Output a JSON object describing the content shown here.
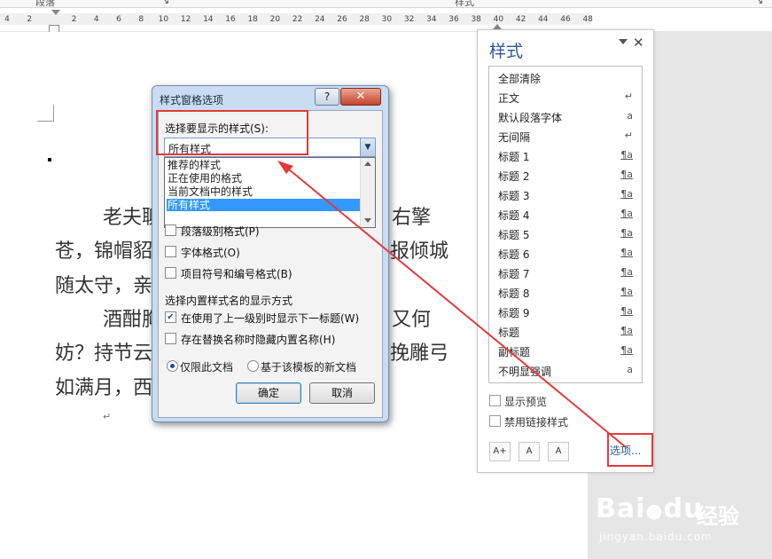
{
  "ribbon": {
    "group_left": "段落",
    "group_right": "样式",
    "launcher": "↘"
  },
  "ruler": {
    "ticks": [
      "4",
      "2",
      "",
      "2",
      "4",
      "6",
      "8",
      "10",
      "12",
      "14",
      "16",
      "18",
      "20",
      "22",
      "24",
      "26",
      "28",
      "30",
      "32",
      "34",
      "36",
      "38",
      "40",
      "42",
      "44",
      "46",
      "48"
    ]
  },
  "document": {
    "lines": [
      "老夫聊",
      "右擎",
      "苍，锦帽貂",
      "报倾城",
      "随太守，亲",
      "酒酣胸",
      "又何",
      "妨？持节云",
      "挽雕弓",
      "如满月，西"
    ],
    "para_mark": "↵"
  },
  "dialog": {
    "title": "样式窗格选项",
    "help": "?",
    "close": "✕",
    "select_label": "选择要显示的样式(S):",
    "combo_value": "所有样式",
    "dropdown_options": [
      "推荐的样式",
      "正在使用的格式",
      "当前文档中的样式",
      "所有样式"
    ],
    "selected_option": "所有样式",
    "format_checks": [
      {
        "label": "段落级别格式(P)",
        "checked": false
      },
      {
        "label": "字体格式(O)",
        "checked": false
      },
      {
        "label": "项目符号和编号格式(B)",
        "checked": false
      }
    ],
    "builtin_label": "选择内置样式名的显示方式",
    "builtin_checks": [
      {
        "label": "在使用了上一级别时显示下一标题(W)",
        "checked": true
      },
      {
        "label": "存在替换名称时隐藏内置名称(H)",
        "checked": false
      }
    ],
    "radio_this_doc": "仅限此文档",
    "radio_template": "基于该模板的新文档",
    "ok": "确定",
    "cancel": "取消"
  },
  "styles_pane": {
    "title": "样式",
    "close": "✕",
    "items": [
      {
        "name": "全部清除",
        "sym": ""
      },
      {
        "name": "正文",
        "sym": "↵"
      },
      {
        "name": "默认段落字体",
        "sym": "a"
      },
      {
        "name": "无间隔",
        "sym": "↵"
      },
      {
        "name": "标题 1",
        "sym": "¶a"
      },
      {
        "name": "标题 2",
        "sym": "¶a"
      },
      {
        "name": "标题 3",
        "sym": "¶a"
      },
      {
        "name": "标题 4",
        "sym": "¶a"
      },
      {
        "name": "标题 5",
        "sym": "¶a"
      },
      {
        "name": "标题 6",
        "sym": "¶a"
      },
      {
        "name": "标题 7",
        "sym": "¶a"
      },
      {
        "name": "标题 8",
        "sym": "¶a"
      },
      {
        "name": "标题 9",
        "sym": "¶a"
      },
      {
        "name": "标题",
        "sym": "¶a"
      },
      {
        "name": "副标题",
        "sym": "¶a"
      },
      {
        "name": "不明显强调",
        "sym": "a"
      }
    ],
    "show_preview": "显示预览",
    "disable_linked": "禁用链接样式",
    "icon_new": "A+",
    "icon_inspect": "A",
    "icon_manage": "A",
    "options": "选项..."
  },
  "watermark": {
    "brand": "Bai",
    "brand_du": "du",
    "cn": "经验",
    "sub": "jingyan.baidu.com"
  },
  "colors": {
    "accent": "#2b579a",
    "highlight": "#e33a3a",
    "selection": "#3399ff"
  }
}
